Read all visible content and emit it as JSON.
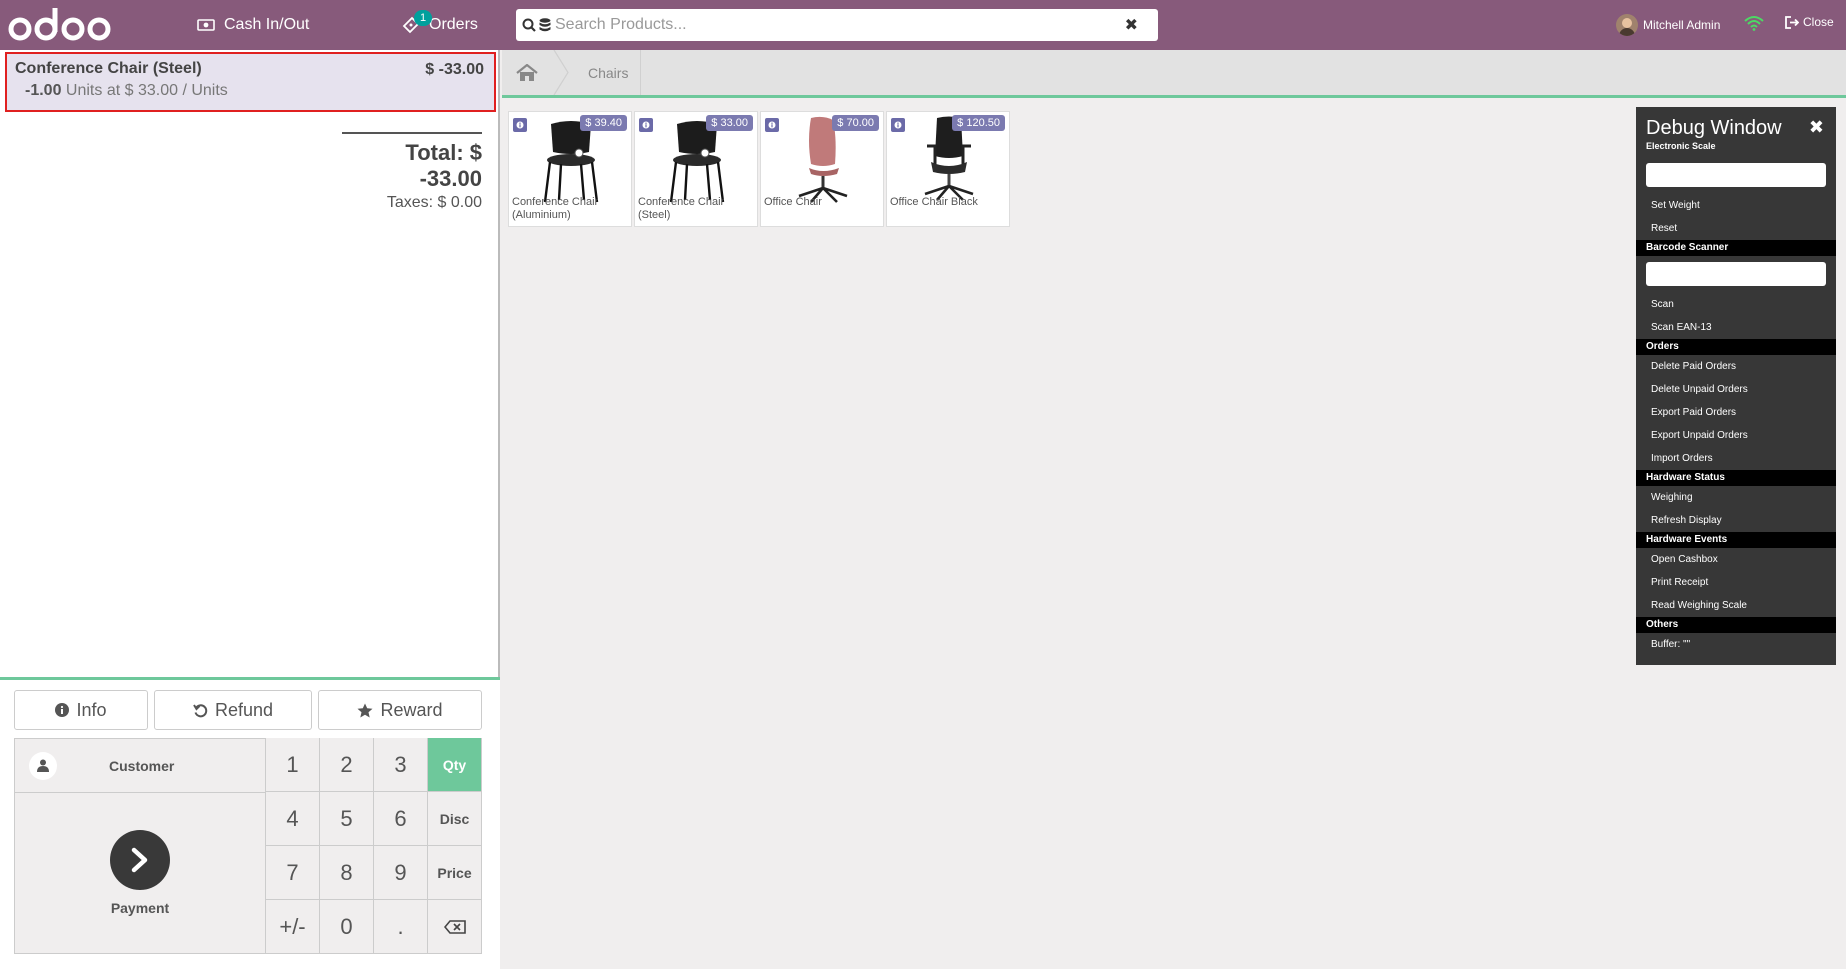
{
  "header": {
    "cash_label": "Cash In/Out",
    "orders_label": "Orders",
    "orders_badge": "1",
    "search_placeholder": "Search Products...",
    "user_name": "Mitchell Admin",
    "close_label": "Close"
  },
  "order": {
    "line": {
      "name": "Conference Chair (Steel)",
      "price": "$ -33.00",
      "qty": "-1.00",
      "detail": "Units at $ 33.00 / Units"
    },
    "total": "Total: $ -33.00",
    "taxes": "Taxes: $ 0.00"
  },
  "controls": {
    "info": "Info",
    "refund": "Refund",
    "reward": "Reward",
    "customer": "Customer",
    "payment": "Payment",
    "numpad": [
      "1",
      "2",
      "3",
      "Qty",
      "4",
      "5",
      "6",
      "Disc",
      "7",
      "8",
      "9",
      "Price",
      "+/-",
      "0",
      ".",
      "backspace"
    ],
    "active_mode": "Qty"
  },
  "breadcrumb": {
    "category": "Chairs"
  },
  "products": [
    {
      "name": "Conference Chair (Aluminium)",
      "price": "$ 39.40",
      "image": "black-conference-chair"
    },
    {
      "name": "Conference Chair (Steel)",
      "price": "$ 33.00",
      "image": "black-conference-chair"
    },
    {
      "name": "Office Chair",
      "price": "$ 70.00",
      "image": "pink-office-chair"
    },
    {
      "name": "Office Chair Black",
      "price": "$ 120.50",
      "image": "black-office-chair"
    }
  ],
  "debug": {
    "title": "Debug Window",
    "scale_section": "Electronic Scale",
    "set_weight": "Set Weight",
    "reset": "Reset",
    "barcode_section": "Barcode Scanner",
    "scan": "Scan",
    "scan_ean": "Scan EAN-13",
    "orders_section": "Orders",
    "delete_paid": "Delete Paid Orders",
    "delete_unpaid": "Delete Unpaid Orders",
    "export_paid": "Export Paid Orders",
    "export_unpaid": "Export Unpaid Orders",
    "import_orders": "Import Orders",
    "hw_status_section": "Hardware Status",
    "weighing": "Weighing",
    "refresh_display": "Refresh Display",
    "hw_events_section": "Hardware Events",
    "open_cashbox": "Open Cashbox",
    "print_receipt": "Print Receipt",
    "read_scale": "Read Weighing Scale",
    "others_section": "Others",
    "buffer": "Buffer: \"\""
  },
  "colors": {
    "header": "#875a7b",
    "accent": "#6ec89b",
    "selected_line_border": "#e02020",
    "badge": "#00a09d"
  }
}
